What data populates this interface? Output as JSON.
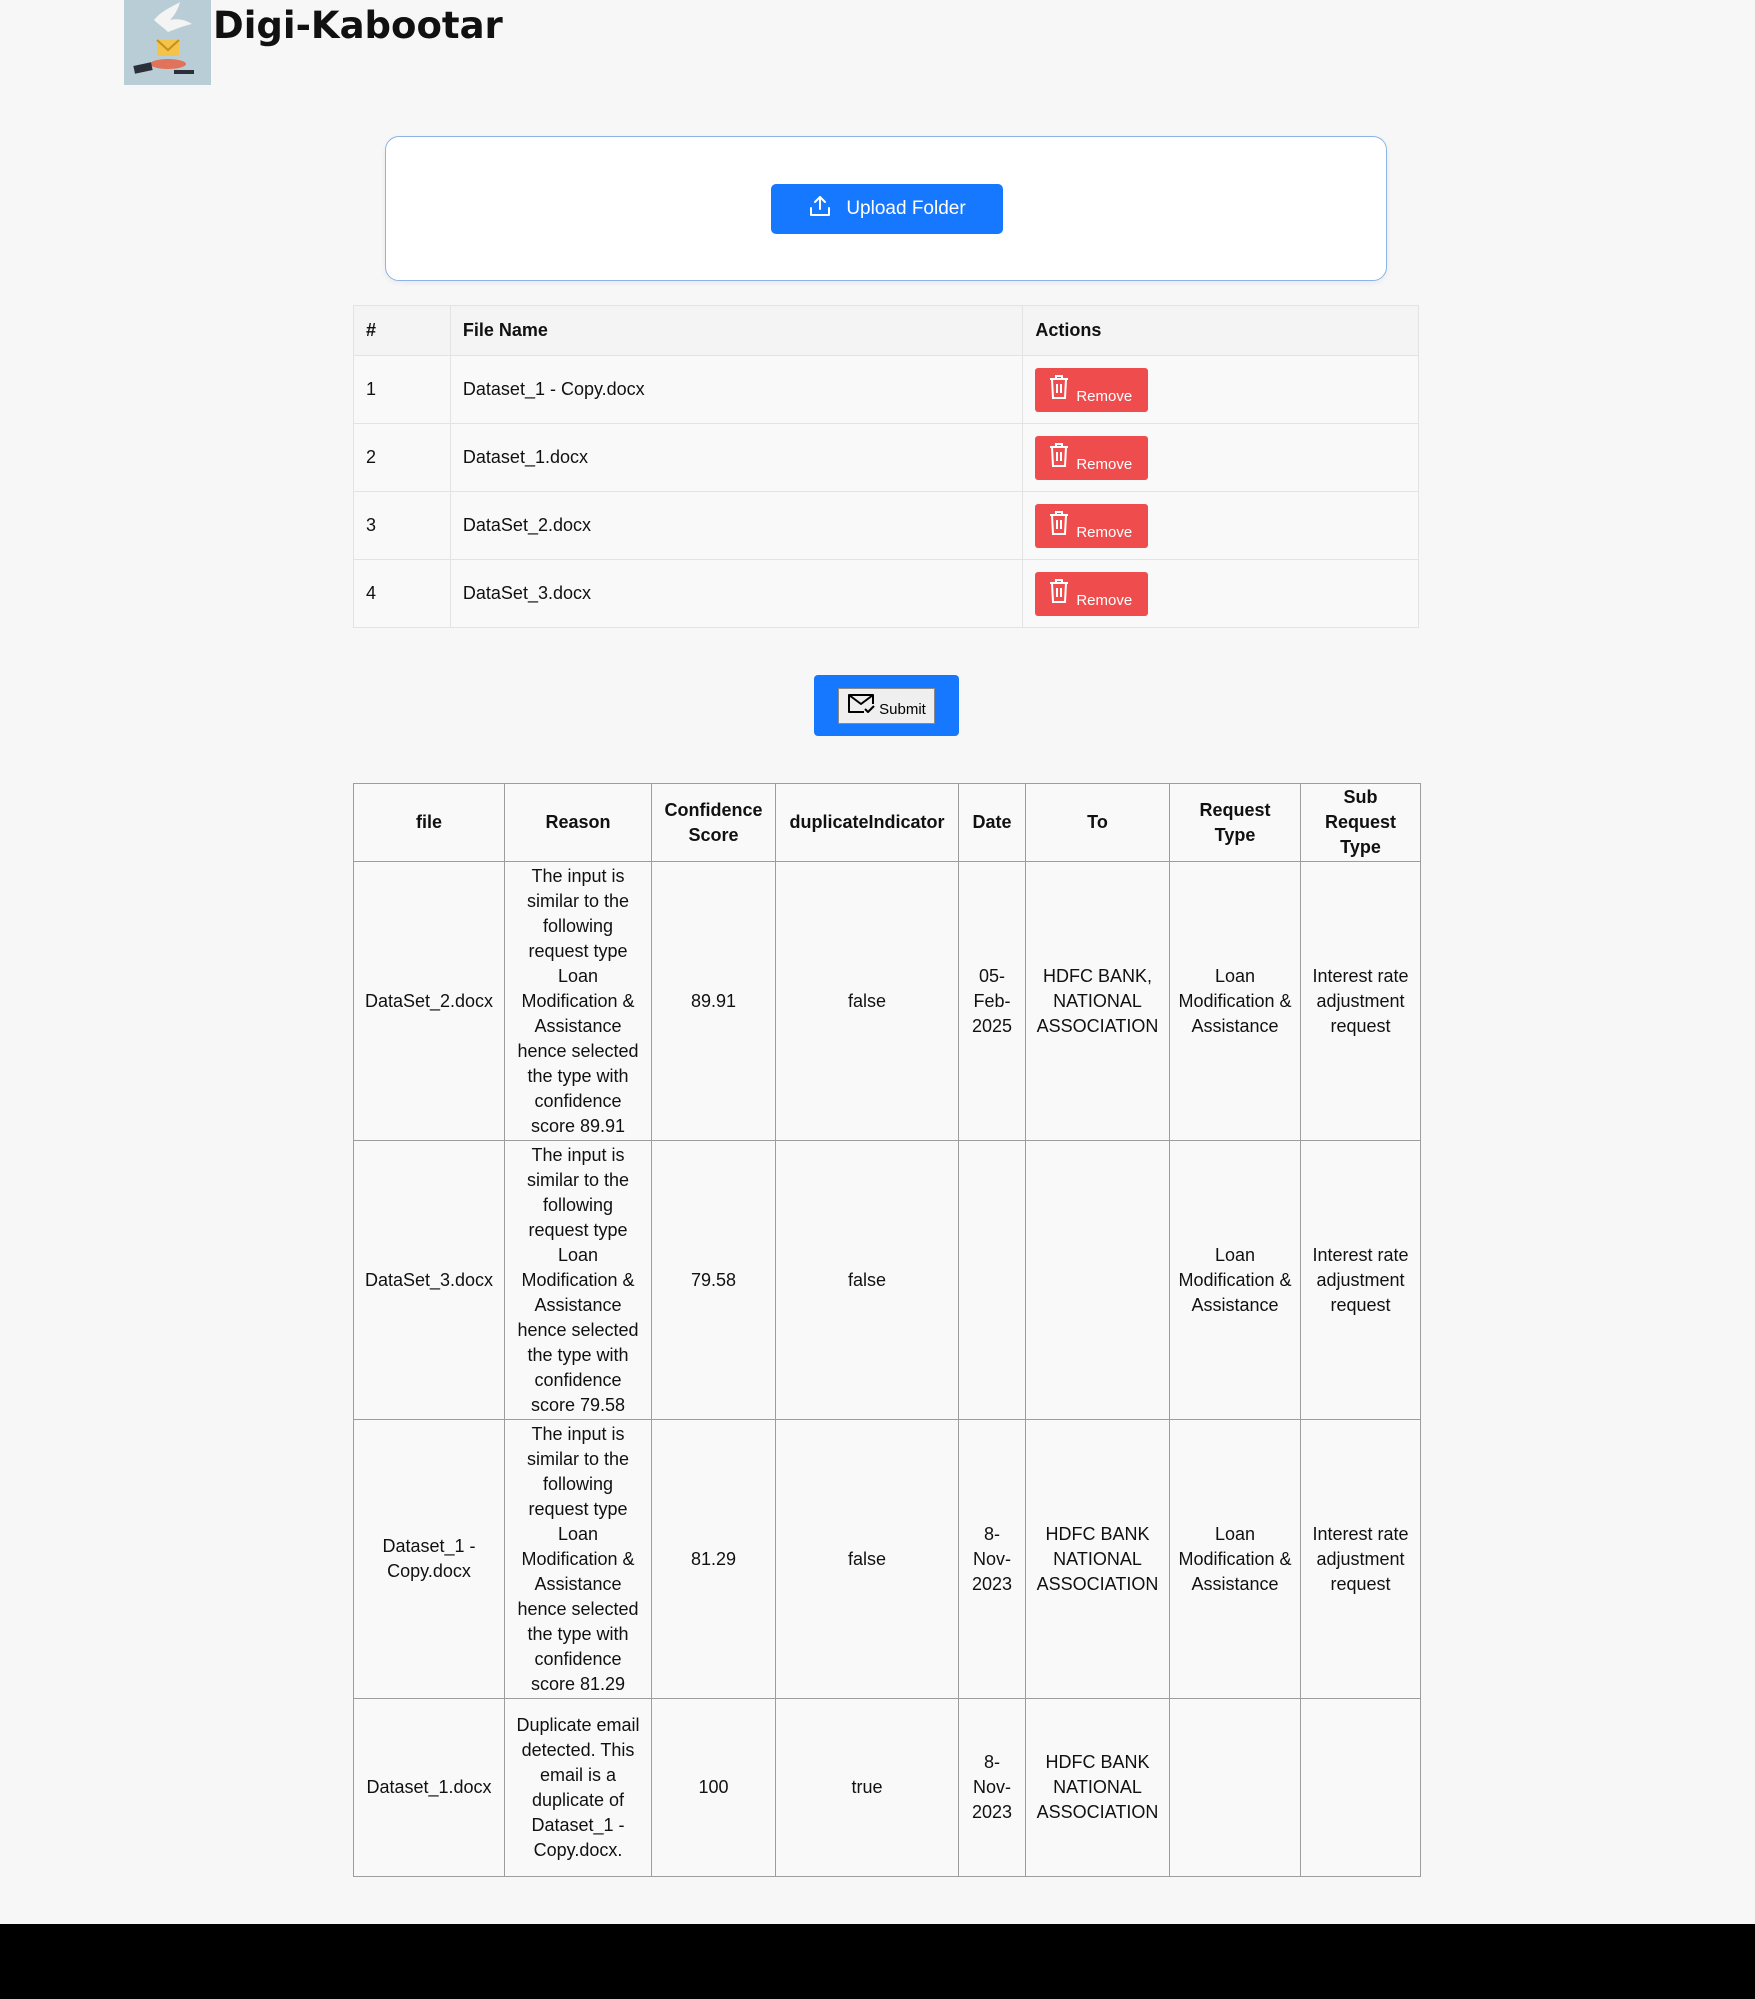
{
  "header": {
    "app_title": "Digi-Kabootar"
  },
  "upload": {
    "button_label": "Upload Folder"
  },
  "file_table": {
    "headers": [
      "#",
      "File Name",
      "Actions"
    ],
    "rows": [
      {
        "index": "1",
        "file_name": "Dataset_1 - Copy.docx",
        "action": "Remove"
      },
      {
        "index": "2",
        "file_name": "Dataset_1.docx",
        "action": "Remove"
      },
      {
        "index": "3",
        "file_name": "DataSet_2.docx",
        "action": "Remove"
      },
      {
        "index": "4",
        "file_name": "DataSet_3.docx",
        "action": "Remove"
      }
    ]
  },
  "submit": {
    "label": "Submit"
  },
  "results_table": {
    "headers": [
      "file",
      "Reason",
      "Confidence Score",
      "duplicateIndicator",
      "Date",
      "To",
      "Request Type",
      "Sub Request Type"
    ],
    "rows": [
      {
        "file": "DataSet_2.docx",
        "reason": "The input is similar to the following request type Loan Modification & Assistance hence selected the type with confidence score 89.91",
        "confidence": "89.91",
        "duplicate": "false",
        "date": "05-Feb-2025",
        "to": "HDFC BANK, NATIONAL ASSOCIATION",
        "request_type": "Loan Modification & Assistance",
        "sub_request_type": "Interest rate adjustment request"
      },
      {
        "file": "DataSet_3.docx",
        "reason": "The input is similar to the following request type Loan Modification & Assistance hence selected the type with confidence score 79.58",
        "confidence": "79.58",
        "duplicate": "false",
        "date": "",
        "to": "",
        "request_type": "Loan Modification & Assistance",
        "sub_request_type": "Interest rate adjustment request"
      },
      {
        "file": "Dataset_1 - Copy.docx",
        "reason": "The input is similar to the following request type Loan Modification & Assistance hence selected the type with confidence score 81.29",
        "confidence": "81.29",
        "duplicate": "false",
        "date": "8-Nov-2023",
        "to": "HDFC BANK NATIONAL ASSOCIATION",
        "request_type": "Loan Modification & Assistance",
        "sub_request_type": "Interest rate adjustment request"
      },
      {
        "file": "Dataset_1.docx",
        "reason": "Duplicate email detected. This email is a duplicate of Dataset_1 - Copy.docx.",
        "confidence": "100",
        "duplicate": "true",
        "date": "8-Nov-2023",
        "to": "HDFC BANK NATIONAL ASSOCIATION",
        "request_type": "",
        "sub_request_type": ""
      }
    ]
  },
  "colors": {
    "primary": "#1677ff",
    "danger": "#ef4d4d",
    "background": "#f7f7f7"
  },
  "icons": {
    "upload": "upload-icon",
    "trash": "trash-icon",
    "mail": "mail-check-icon",
    "logo": "dove-mail-logo"
  }
}
